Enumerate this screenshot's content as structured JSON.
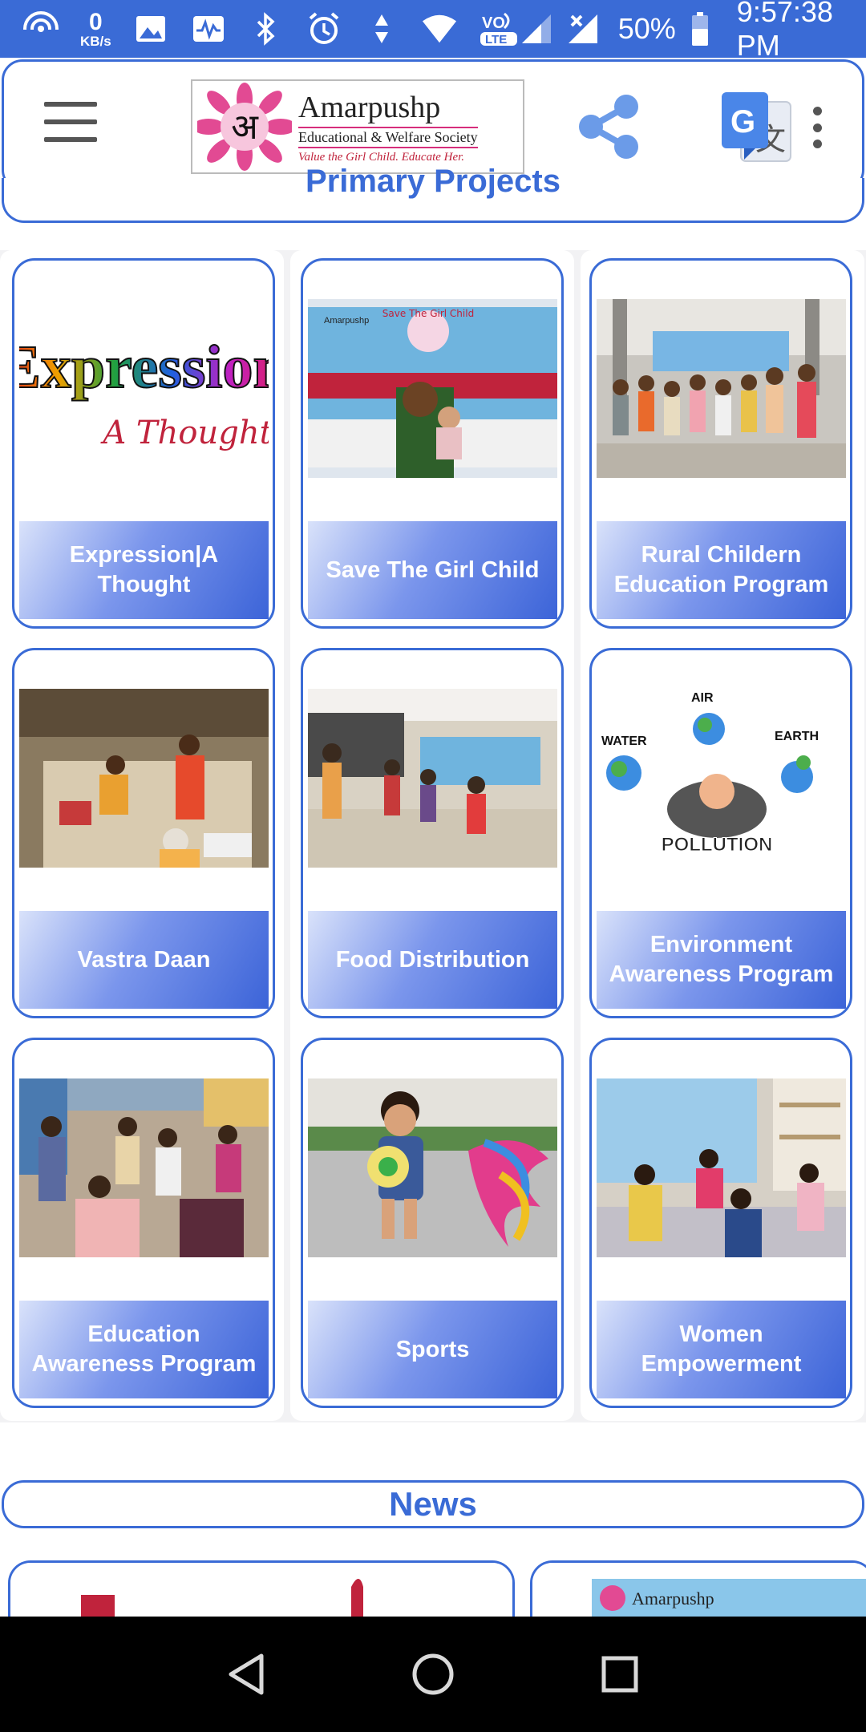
{
  "status_bar": {
    "net_speed_value": "0",
    "net_speed_unit": "KB/s",
    "volte_label": "VO",
    "lte_label": "LTE",
    "battery": "50%",
    "time": "9:57:38 PM",
    "icons": [
      "hotspot-icon",
      "image-icon",
      "activity-icon",
      "bluetooth-icon",
      "alarm-icon",
      "data-arrows-icon",
      "wifi-icon",
      "volte-icon",
      "signal-icon",
      "signal-no-data-icon",
      "battery-icon"
    ]
  },
  "header": {
    "logo": {
      "glyph": "अ",
      "title": "Amarpushp",
      "subtitle": "Educational & Welfare Society",
      "tagline": "Value the Girl Child. Educate Her."
    },
    "icons": [
      "menu-icon",
      "share-icon",
      "translate-icon",
      "more-vert-icon"
    ]
  },
  "sections": {
    "primary_title": "Primary Projects",
    "news_title": "News"
  },
  "projects": [
    {
      "label": "Expression|A Thought",
      "image": "expression-logo"
    },
    {
      "label": "Save The Girl Child",
      "image": "girl-child-banner-photo"
    },
    {
      "label": "Rural Childern Education Program",
      "image": "children-group-photo"
    },
    {
      "label": "Vastra Daan",
      "image": "clothes-donation-photo"
    },
    {
      "label": "Food Distribution",
      "image": "food-distribution-photo"
    },
    {
      "label": "Environment Awareness Program",
      "image": "pollution-diagram"
    },
    {
      "label": "Education Awareness Program",
      "image": "education-gathering-photo"
    },
    {
      "label": "Sports",
      "image": "child-with-ball-photo"
    },
    {
      "label": "Women Empowerment",
      "image": "women-meeting-photo"
    }
  ],
  "artwork_text": {
    "expression_word": "Expression",
    "expression_sub": "A Thought",
    "banner_title": "Save The Girl Child",
    "banner_org": "Amarpushp",
    "pollution_word": "POLLUTION",
    "pollution_air": "AIR",
    "pollution_water": "WATER",
    "pollution_earth": "EARTH",
    "news_logo_word": "Amarpushp"
  },
  "colors": {
    "accent": "#3a6bd6",
    "status_bar": "#3a6bd6",
    "nav_bar": "#000000",
    "logo_pink": "#d62e7b"
  },
  "nav": {
    "icons": [
      "back-icon",
      "home-icon",
      "recents-icon"
    ]
  }
}
